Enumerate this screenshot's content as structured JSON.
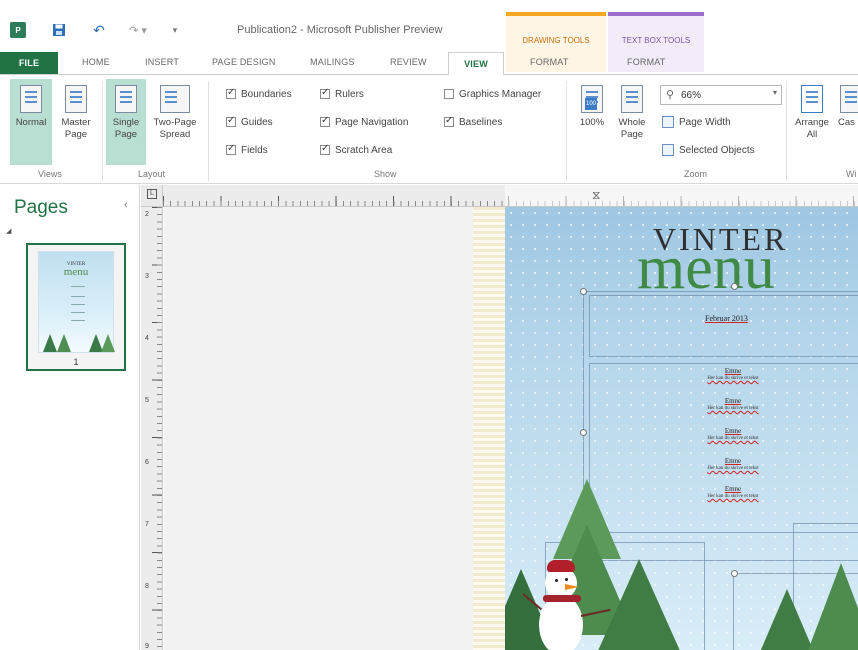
{
  "window": {
    "title": "Publication2 - Microsoft Publisher Preview",
    "app_icon_label": "P",
    "redo_glyph": "↷ ▾",
    "more_glyph": "▾",
    "undo_glyph": "↶"
  },
  "contextual_groups": {
    "drawing_tools": "DRAWING TOOLS",
    "text_box_tools": "TEXT BOX TOOLS"
  },
  "tabs": {
    "file": "FILE",
    "home": "HOME",
    "insert": "INSERT",
    "page_design": "PAGE DESIGN",
    "mailings": "MAILINGS",
    "review": "REVIEW",
    "view": "VIEW",
    "format_drawing": "FORMAT",
    "format_textbox": "FORMAT"
  },
  "ribbon": {
    "views": {
      "label": "Views",
      "normal": "Normal",
      "master_page_1": "Master",
      "master_page_2": "Page"
    },
    "layout": {
      "label": "Layout",
      "single_page_1": "Single",
      "single_page_2": "Page",
      "two_page_1": "Two-Page",
      "two_page_2": "Spread"
    },
    "show": {
      "label": "Show",
      "boundaries": "Boundaries",
      "guides": "Guides",
      "fields": "Fields",
      "rulers": "Rulers",
      "page_navigation": "Page Navigation",
      "scratch_area": "Scratch Area",
      "graphics_manager": "Graphics Manager",
      "baselines": "Baselines"
    },
    "zoom": {
      "label": "Zoom",
      "hundred": "100%",
      "whole_page_1": "Whole",
      "whole_page_2": "Page",
      "zoom_value": "66%",
      "page_width": "Page Width",
      "selected_objects": "Selected Objects"
    },
    "window": {
      "label": "Wi",
      "arrange_all_1": "Arrange",
      "arrange_all_2": "All",
      "cascade": "Cas"
    }
  },
  "pages_pane": {
    "title": "Pages",
    "collapse_glyph": "‹",
    "expander_glyph": "◢",
    "page_number": "1",
    "thumb_word1": "VINTER",
    "thumb_word2": "menu"
  },
  "ruler": {
    "corner_glyph": "L",
    "marker_glyph": "⧖",
    "v_numbers": [
      "2",
      "3",
      "4",
      "5",
      "6",
      "7",
      "8",
      "9"
    ]
  },
  "publication": {
    "title_line1": "VINTER",
    "title_line2": "menu",
    "date": "Februar 2013",
    "menu_items": [
      {
        "title": "Emne",
        "desc": "Her kan du skrive et tekst"
      },
      {
        "title": "Emne",
        "desc": "Her kan du skrive et tekst"
      },
      {
        "title": "Emne",
        "desc": "Her kan du skrive et tekst"
      },
      {
        "title": "Emne",
        "desc": "Her kan du skrive et tekst"
      },
      {
        "title": "Emne",
        "desc": "Her kan du skrive et tekst"
      }
    ]
  },
  "colors": {
    "accent": "#217346",
    "drawing_tools": "#f6a623",
    "text_box_tools": "#9b6fc8",
    "title_green": "#3f8a45"
  }
}
